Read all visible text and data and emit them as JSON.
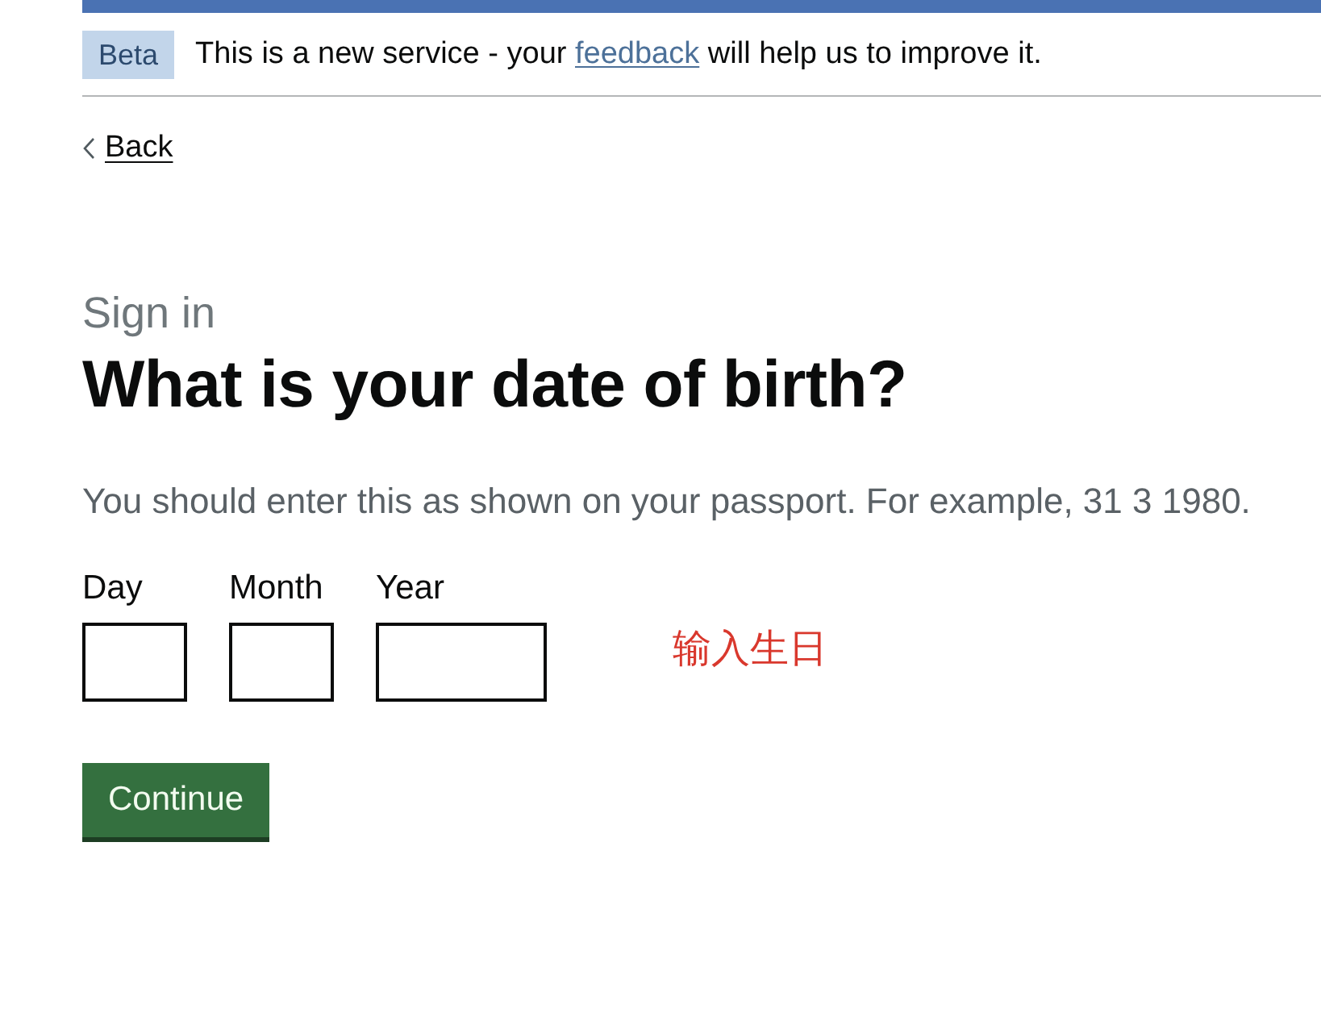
{
  "phase_banner": {
    "tag": "Beta",
    "text_before": "This is a new service - your",
    "link": "feedback",
    "text_after": "will help us to improve it."
  },
  "back_link": {
    "label": "Back"
  },
  "caption": "Sign in",
  "heading": "What is your date of birth?",
  "hint": "You should enter this as shown on your passport. For example, 31 3 1980.",
  "date_fields": [
    {
      "label": "Day",
      "kind": "short"
    },
    {
      "label": "Month",
      "kind": "short"
    },
    {
      "label": "Year",
      "kind": "long"
    }
  ],
  "annotation": "输入生日",
  "button": {
    "label": "Continue"
  }
}
